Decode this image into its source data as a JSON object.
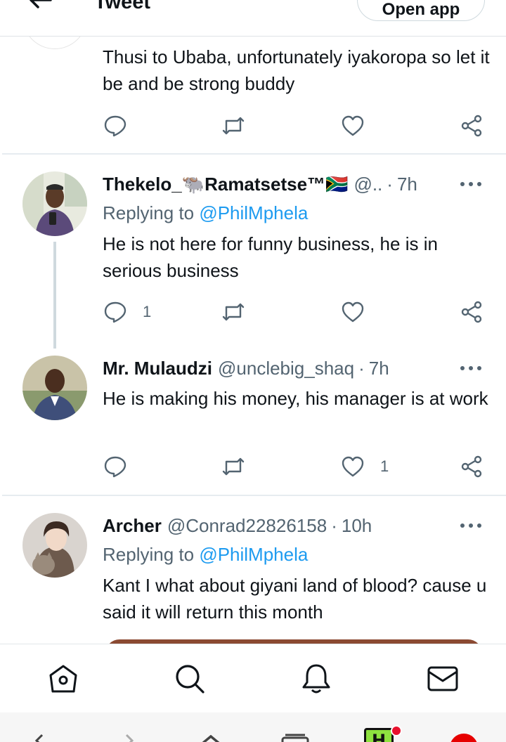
{
  "header": {
    "title": "Tweet",
    "open_app_label": "Open app"
  },
  "tweets": [
    {
      "text": "Thusi to Ubaba, unfortunately iyakoropa so let it be and be strong buddy"
    },
    {
      "name": "Thekelo_🐃Ramatsetse™🇿🇦",
      "handle": "@..",
      "time": "7h",
      "replying_prefix": "Replying to ",
      "replying_to": "@PhilMphela",
      "text": "He is not here for funny business,  he is in serious business",
      "reply_count": "1"
    },
    {
      "name": "Mr. Mulaudzi",
      "handle": "@unclebig_shaq",
      "time": "7h",
      "text": "He is making his money, his manager is at work",
      "like_count": "1"
    },
    {
      "name": "Archer",
      "handle": "@Conrad22826158",
      "time": "10h",
      "replying_prefix": "Replying to ",
      "replying_to": "@PhilMphela",
      "text": "Kant I what about giyani land of blood? cause u said it will return this month"
    }
  ],
  "separator": "·",
  "colors": {
    "accent": "#1d9bf0",
    "secondary_text": "#536471",
    "primary_text": "#0f1419",
    "divider": "#e6ecf0"
  },
  "bottom_nav": [
    "home-icon",
    "search-icon",
    "notifications-bell-icon",
    "messages-mail-icon"
  ],
  "system_bar": [
    "browser-back-icon",
    "browser-forward-icon",
    "home-icon",
    "tabs-icon",
    "app-h-icon",
    "app-vodacom-icon"
  ]
}
